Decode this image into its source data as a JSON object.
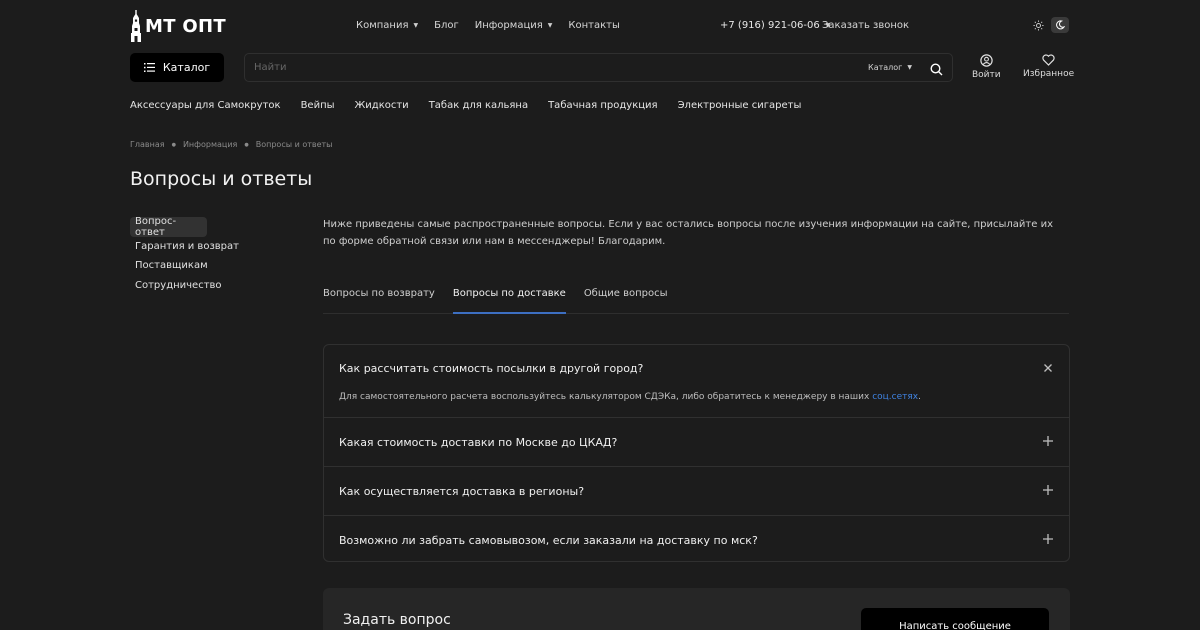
{
  "logo": {
    "text": "МТ ОПТ"
  },
  "topnav": [
    {
      "label": "Компания",
      "dropdown": true
    },
    {
      "label": "Блог",
      "dropdown": false
    },
    {
      "label": "Информация",
      "dropdown": true
    },
    {
      "label": "Контакты",
      "dropdown": false
    }
  ],
  "header": {
    "phone": "+7 (916) 921-06-06",
    "callback": "Заказать звонок"
  },
  "catalog_button": "Каталог",
  "search": {
    "placeholder": "Найти",
    "value": "",
    "category": "Каталог"
  },
  "account": {
    "login": "Войти",
    "favorites": "Избранное"
  },
  "categories": [
    "Аксессуары для Самокруток",
    "Вейпы",
    "Жидкости",
    "Табак для кальяна",
    "Табачная продукция",
    "Электронные сигареты"
  ],
  "breadcrumbs": [
    "Главная",
    "Информация",
    "Вопросы и ответы"
  ],
  "page_title": "Вопросы и ответы",
  "sidebar": [
    {
      "label": "Вопрос-ответ",
      "active": true
    },
    {
      "label": "Гарантия и возврат",
      "active": false
    },
    {
      "label": "Поставщикам",
      "active": false
    },
    {
      "label": "Сотрудничество",
      "active": false
    }
  ],
  "intro": "Ниже приведены самые распространенные вопросы. Если у вас остались вопросы после изучения информации на сайте, присылайте их по форме обратной связи или нам в мессенджеры! Благодарим.",
  "tabs": [
    {
      "label": "Вопросы по возврату",
      "active": false
    },
    {
      "label": "Вопросы по доставке",
      "active": true
    },
    {
      "label": "Общие вопросы",
      "active": false
    }
  ],
  "faq": [
    {
      "question": "Как рассчитать стоимость посылки в другой город?",
      "open": true,
      "answer_text": "Для самостоятельного расчета воспользуйтесь калькулятором СДЭКа, либо обратитесь к менеджеру в наших ",
      "answer_link": "соц.сетях",
      "answer_end": "."
    },
    {
      "question": "Какая стоимость доставки по Москве до ЦКАД?",
      "open": false
    },
    {
      "question": "Как осуществляется доставка в регионы?",
      "open": false
    },
    {
      "question": "Возможно ли забрать самовывозом, если заказали на доставку по мск?",
      "open": false
    }
  ],
  "ask": {
    "title": "Задать вопрос",
    "button": "Написать сообщение"
  },
  "colors": {
    "background": "#1c1c1c",
    "accent_tab": "#3d6fc2",
    "link": "#3f82e0"
  }
}
